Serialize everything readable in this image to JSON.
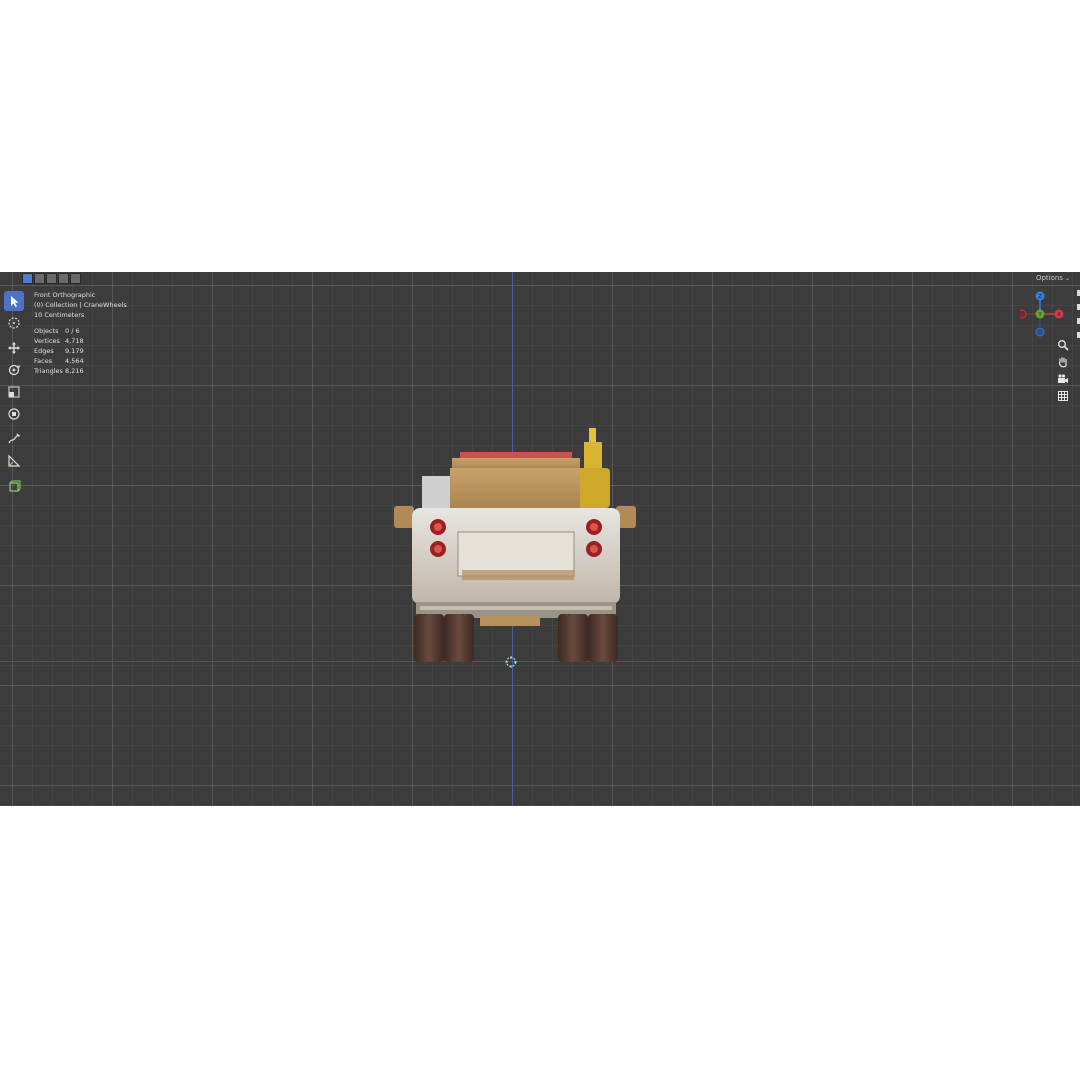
{
  "header": {
    "mode_buttons": [
      "select-new",
      "select-extend",
      "select-subtract",
      "select-invert",
      "select-intersect"
    ],
    "options_label": "Options"
  },
  "toolbar": {
    "tools": [
      "select-box",
      "cursor",
      "move",
      "rotate",
      "scale",
      "transform",
      "annotate",
      "measure",
      "add-cube"
    ],
    "active": "select-box"
  },
  "overlay": {
    "view_name": "Front Orthographic",
    "collection": "(0) Collection | CraneWheels",
    "scale": "10 Centimeters",
    "stats": [
      {
        "label": "Objects",
        "value": "0 / 6"
      },
      {
        "label": "Vertices",
        "value": "4,718"
      },
      {
        "label": "Edges",
        "value": "9,179"
      },
      {
        "label": "Faces",
        "value": "4,564"
      },
      {
        "label": "Triangles",
        "value": "8,216"
      }
    ]
  },
  "gizmo": {
    "z_label": "Z",
    "y_label": "Y",
    "x_label": "X",
    "colors": {
      "x": "#d5394b",
      "y": "#6fa12f",
      "z": "#3a7de0"
    }
  },
  "nav_icons": [
    "zoom-icon",
    "hand-icon",
    "camera-icon",
    "grid-icon"
  ],
  "colors": {
    "viewport_bg": "#3c3c3c",
    "accent": "#4f72c4",
    "axis_x": "#8a3a44",
    "axis_z": "#4a5fa0"
  }
}
